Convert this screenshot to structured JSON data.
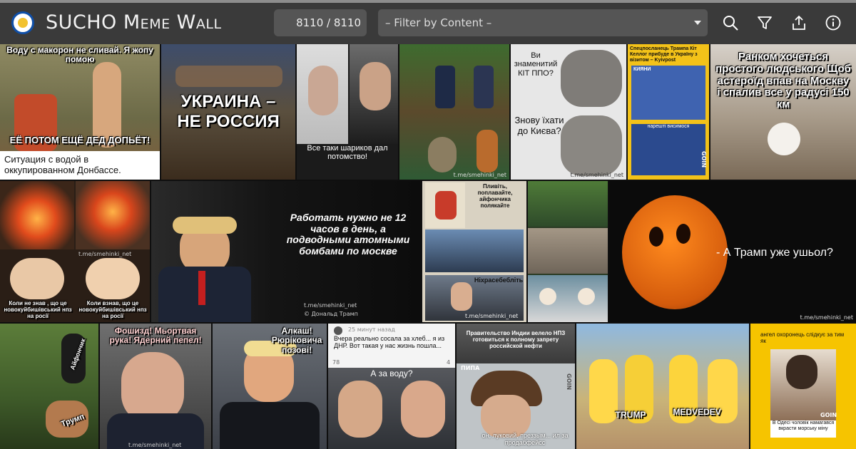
{
  "header": {
    "title": "SUCHO Meme Wall",
    "counter": "8110 / 8110",
    "filter_placeholder": "– Filter by Content –",
    "icons": [
      "search-icon",
      "filter-icon",
      "share-icon",
      "info-icon"
    ]
  },
  "tiles": {
    "water": {
      "top": "Воду с макорон не сливай. Я жопу помою",
      "bottom": "ЕЁ ПОТОМ ЕЩЁ ДЕД ДОПЬЁТ!",
      "caption": "Ситуация с водой в оккупированном Донбассе."
    },
    "cossacks": {
      "line1": "УКРАИНА –",
      "line2": "НЕ РОССИЯ"
    },
    "sharikov": {
      "caption": "Все таки шариков дал потомство!"
    },
    "bench": {
      "watermark": "t.me/smehinki_net"
    },
    "cat": {
      "q1": "Ви знаменитий КІТ ППО?",
      "q2": "Знову їхати до Києва?",
      "watermark": "t.me/smehinki_net"
    },
    "trump_kellogg": {
      "header": "Спецпосланець Трампа Кіт Келлог прибуде в Україну з візитом – Kyivpost",
      "label1": "КИЯНИ",
      "label2": "нарешті висимося",
      "brand": "GOIN"
    },
    "asteroid": {
      "text": "Ранком хочеться простого людського Щоб астероїд впав на Москву і спалив все у радусі 150 км"
    },
    "chihuahua": {
      "cap1": "Коли не знав , що це новокуйбишівський нпз на росії",
      "cap2": "Коли взнав, що це новокуйбишівський нпз на росії",
      "watermark": "t.me/smehinki_net"
    },
    "trump_speech": {
      "text": "Работать нужно не 12 часов в день, а подводными атомными бомбами по москве",
      "watermark": "t.me/smehinki_net",
      "credit": "© Дональд Трамп"
    },
    "unclesam": {
      "cap": "Пливіть, поплавайте, айфончика полякайте",
      "cap2": "Ніхрасебебліть",
      "watermark": "t.me/smehinki_net"
    },
    "vinnie": {
      "text": "- А Трамп уже ушьол?",
      "watermark": "t.me/smehinki_net"
    },
    "bears": {
      "label1": "Айфончик",
      "label2": "Трумп"
    },
    "medvedev": {
      "text": "Фошизд! Мьортвая рука! Ядерний пепел!",
      "watermark": "t.me/smehinki_net"
    },
    "trump_uniform": {
      "text": "Алкаш! Рюріковича позові!"
    },
    "social": {
      "time": "25 минут назад",
      "post": "Вчера реально сосала за хлеб... я из ДНР. Вот такая у нас жизнь пошла...",
      "counts": [
        "78",
        "4"
      ],
      "q": "А за воду?"
    },
    "india": {
      "text": "Правительство Индии велело НПЗ готовиться к полному запрету российской нефти",
      "cap2": "он, луковий, преззым... ил за продабфейсс",
      "label": "ПИПА",
      "brand": "GOIN"
    },
    "simpsons": {
      "label1": "TRUMP",
      "label2": "MEDVEDEV"
    },
    "angel": {
      "cap": "ангел охоронець слідкує за тим як",
      "cap2": "В Одесі чоловік намагався вкрасти морську міну",
      "brand": "GOIN"
    }
  }
}
